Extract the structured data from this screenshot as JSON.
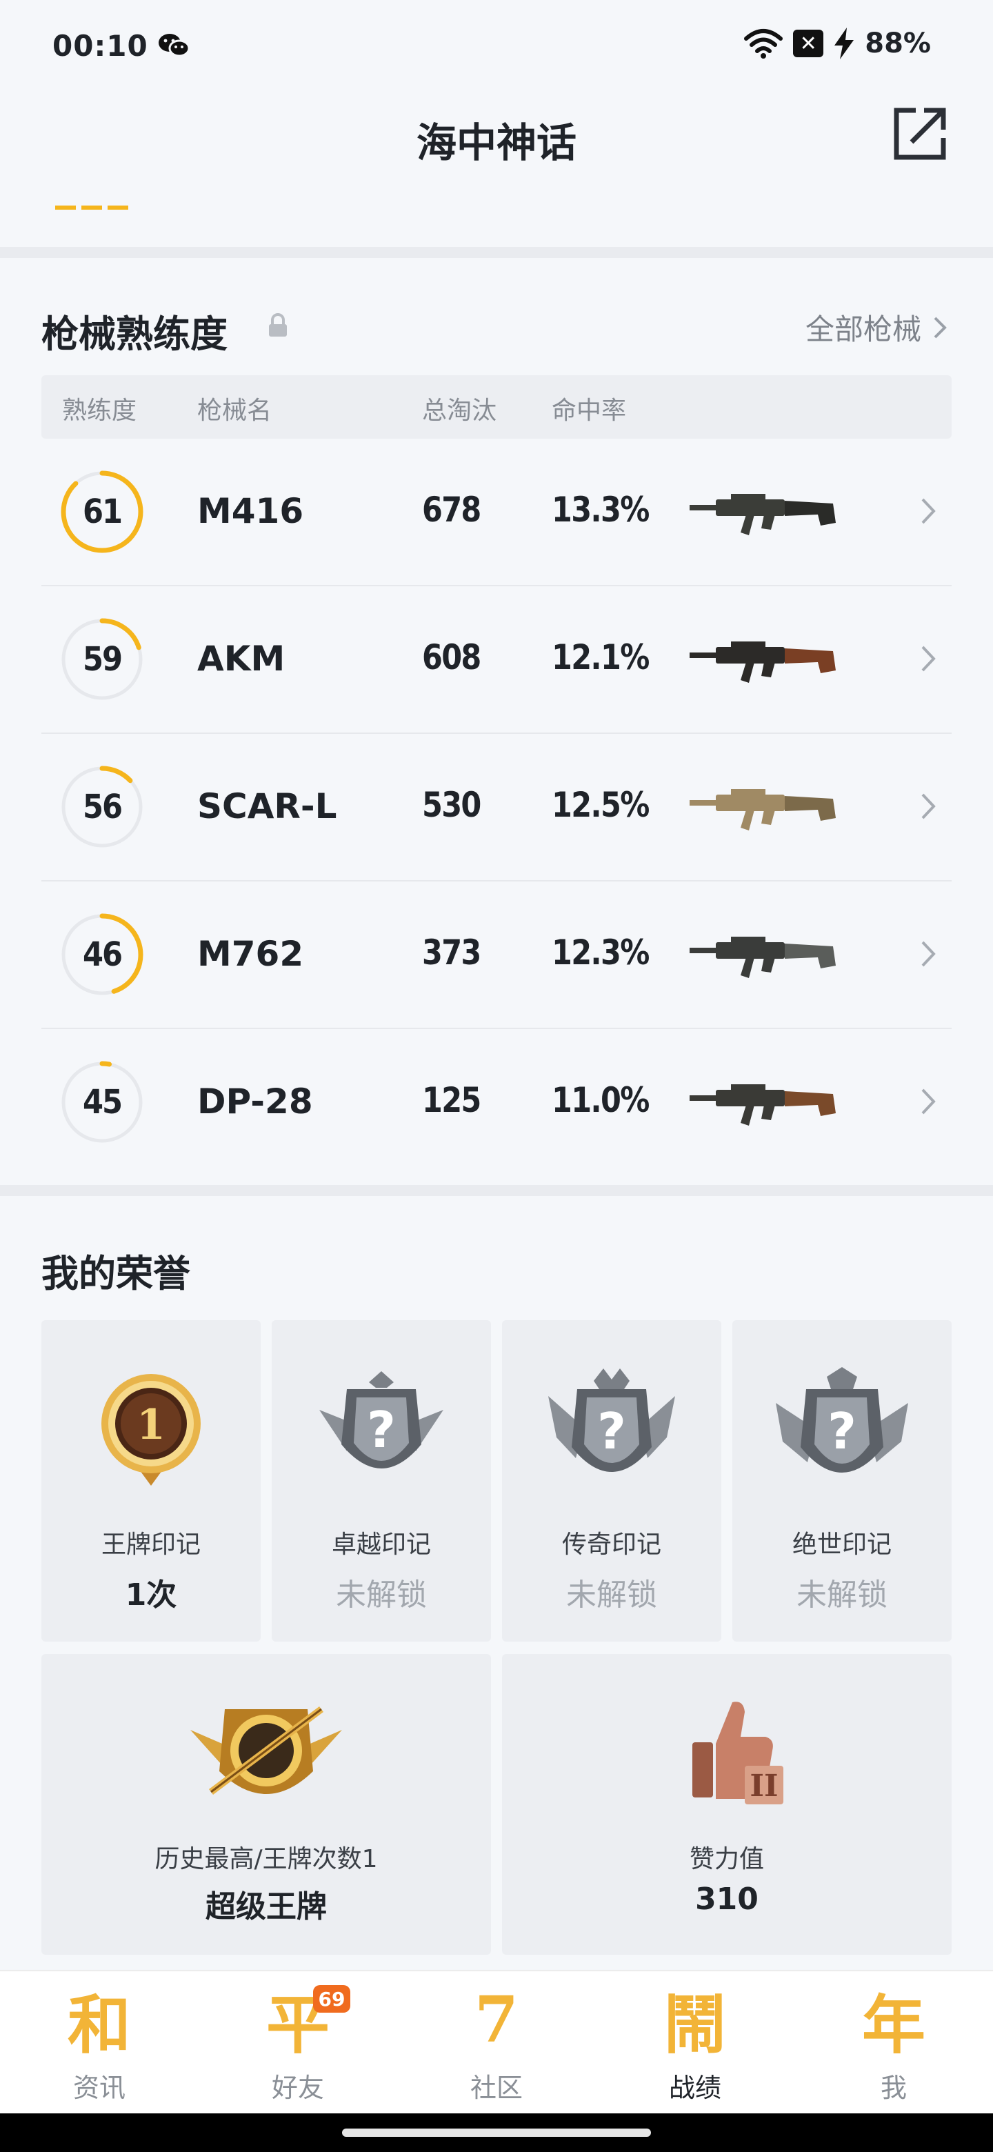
{
  "status_bar": {
    "time": "00:10",
    "battery": "88%"
  },
  "header": {
    "title": "海中神话"
  },
  "weapons_section": {
    "title": "枪械熟练度",
    "all_link": "全部枪械",
    "columns": [
      "熟练度",
      "枪械名",
      "总淘汰",
      "命中率"
    ],
    "rows": [
      {
        "level": "61",
        "progress": 0.88,
        "name": "M416",
        "eliminations": "678",
        "accuracy": "13.3%",
        "gun_icon": "m416-rifle-icon"
      },
      {
        "level": "59",
        "progress": 0.2,
        "name": "AKM",
        "eliminations": "608",
        "accuracy": "12.1%",
        "gun_icon": "akm-rifle-icon"
      },
      {
        "level": "56",
        "progress": 0.13,
        "name": "SCAR-L",
        "eliminations": "530",
        "accuracy": "12.5%",
        "gun_icon": "scar-l-rifle-icon"
      },
      {
        "level": "46",
        "progress": 0.45,
        "name": "M762",
        "eliminations": "373",
        "accuracy": "12.3%",
        "gun_icon": "m762-rifle-icon"
      },
      {
        "level": "45",
        "progress": 0.03,
        "name": "DP-28",
        "eliminations": "125",
        "accuracy": "11.0%",
        "gun_icon": "dp-28-lmg-icon"
      }
    ]
  },
  "honors_section": {
    "title": "我的荣誉",
    "tiles": [
      {
        "label": "王牌印记",
        "value": "1次",
        "locked": false,
        "icon": "ace-medal-icon"
      },
      {
        "label": "卓越印记",
        "value": "未解锁",
        "locked": true,
        "icon": "locked-crest-icon"
      },
      {
        "label": "传奇印记",
        "value": "未解锁",
        "locked": true,
        "icon": "locked-crest-icon"
      },
      {
        "label": "绝世印记",
        "value": "未解锁",
        "locked": true,
        "icon": "locked-crest-icon"
      }
    ],
    "wide_tiles": [
      {
        "label": "历史最高/王牌次数1",
        "value": "超级王牌",
        "icon": "super-ace-badge-icon"
      },
      {
        "label": "赞力值",
        "value": "310",
        "icon": "thumbs-up-trophy-icon"
      }
    ]
  },
  "tab_bar": {
    "tabs": [
      {
        "label": "资讯",
        "glyph": "和",
        "active": false
      },
      {
        "label": "好友",
        "glyph": "平",
        "active": false,
        "badge": "69"
      },
      {
        "label": "社区",
        "glyph": "7",
        "active": false
      },
      {
        "label": "战绩",
        "glyph": "鬧",
        "active": true
      },
      {
        "label": "我",
        "glyph": "年",
        "active": false
      }
    ]
  },
  "colors": {
    "accent": "#f5b51c",
    "ring_track": "#e6e8ec",
    "badge": "#f06b1e"
  }
}
